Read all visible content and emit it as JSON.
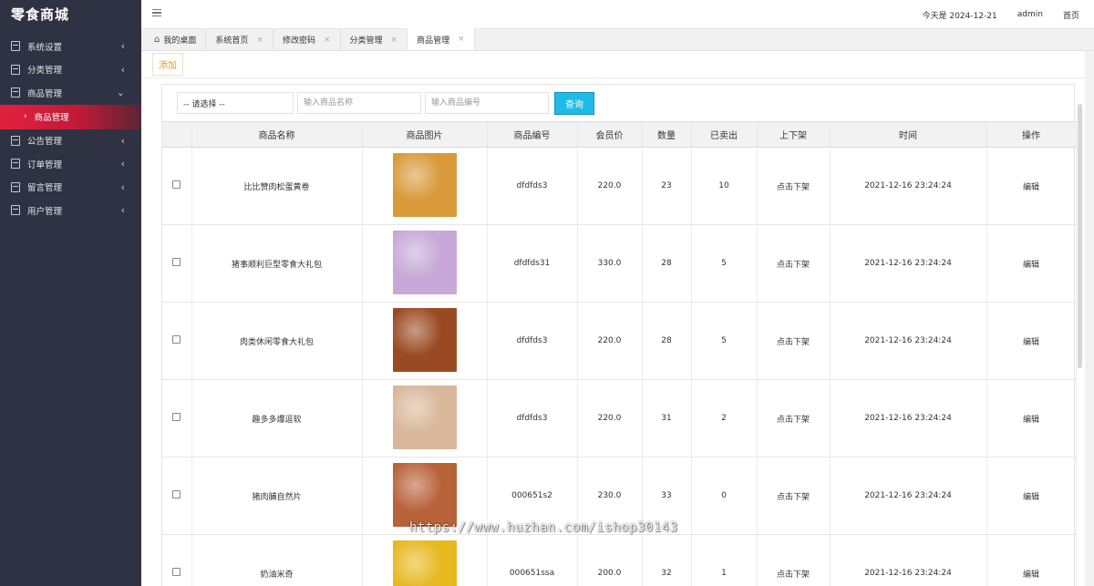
{
  "app": {
    "title": "零食商城"
  },
  "sidebar": {
    "items": [
      {
        "label": "系统设置",
        "arrow": "‹"
      },
      {
        "label": "分类管理",
        "arrow": "‹"
      },
      {
        "label": "商品管理",
        "arrow": "⌄"
      },
      {
        "label": "公告管理",
        "arrow": "‹"
      },
      {
        "label": "订单管理",
        "arrow": "‹"
      },
      {
        "label": "留言管理",
        "arrow": "‹"
      },
      {
        "label": "用户管理",
        "arrow": "‹"
      }
    ],
    "sub_item": {
      "label": "商品管理",
      "arrow": "›"
    }
  },
  "header": {
    "date": "今天是 2024-12-21",
    "user": "admin",
    "home": "首页"
  },
  "tabs": [
    {
      "label": "我的桌面",
      "close": ""
    },
    {
      "label": "系统首页",
      "close": "×"
    },
    {
      "label": "修改密码",
      "close": "×"
    },
    {
      "label": "分类管理",
      "close": "×"
    },
    {
      "label": "商品管理",
      "close": "×"
    }
  ],
  "toolbar": {
    "add_label": "添加"
  },
  "search": {
    "select_value": "-- 请选择 --",
    "name_placeholder": "输入商品名称",
    "code_placeholder": "输入商品编号",
    "query_label": "查询"
  },
  "table": {
    "headers": [
      "",
      "商品名称",
      "商品图片",
      "商品编号",
      "会员价",
      "数量",
      "已卖出",
      "上下架",
      "时间",
      "操作"
    ],
    "rows": [
      {
        "name": "比比赞肉松蛋黄卷",
        "code": "dfdfds3",
        "price": "220.0",
        "qty": "23",
        "sold": "10",
        "shelf": "点击下架",
        "time": "2021-12-16 23:24:24",
        "action": "编辑",
        "img_color": "#d89a3a"
      },
      {
        "name": "猪事顺利巨型零食大礼包",
        "code": "dfdfds31",
        "price": "330.0",
        "qty": "28",
        "sold": "5",
        "shelf": "点击下架",
        "time": "2021-12-16 23:24:24",
        "action": "编辑",
        "img_color": "#c7a8d8"
      },
      {
        "name": "肉类休闲零食大礼包",
        "code": "dfdfds3",
        "price": "220.0",
        "qty": "28",
        "sold": "5",
        "shelf": "点击下架",
        "time": "2021-12-16 23:24:24",
        "action": "编辑",
        "img_color": "#9a4a22"
      },
      {
        "name": "趣多多爆逗软",
        "code": "dfdfds3",
        "price": "220.0",
        "qty": "31",
        "sold": "2",
        "shelf": "点击下架",
        "time": "2021-12-16 23:24:24",
        "action": "编辑",
        "img_color": "#d9b79a"
      },
      {
        "name": "猪肉脯自然片",
        "code": "000651s2",
        "price": "230.0",
        "qty": "33",
        "sold": "0",
        "shelf": "点击下架",
        "time": "2021-12-16 23:24:24",
        "action": "编辑",
        "img_color": "#b8623a"
      },
      {
        "name": "奶油米奇",
        "code": "000651ssa",
        "price": "200.0",
        "qty": "32",
        "sold": "1",
        "shelf": "点击下架",
        "time": "2021-12-16 23:24:24",
        "action": "编辑",
        "img_color": "#e8b81f"
      }
    ]
  },
  "watermark": "https://www.huzhan.com/ishop30143"
}
